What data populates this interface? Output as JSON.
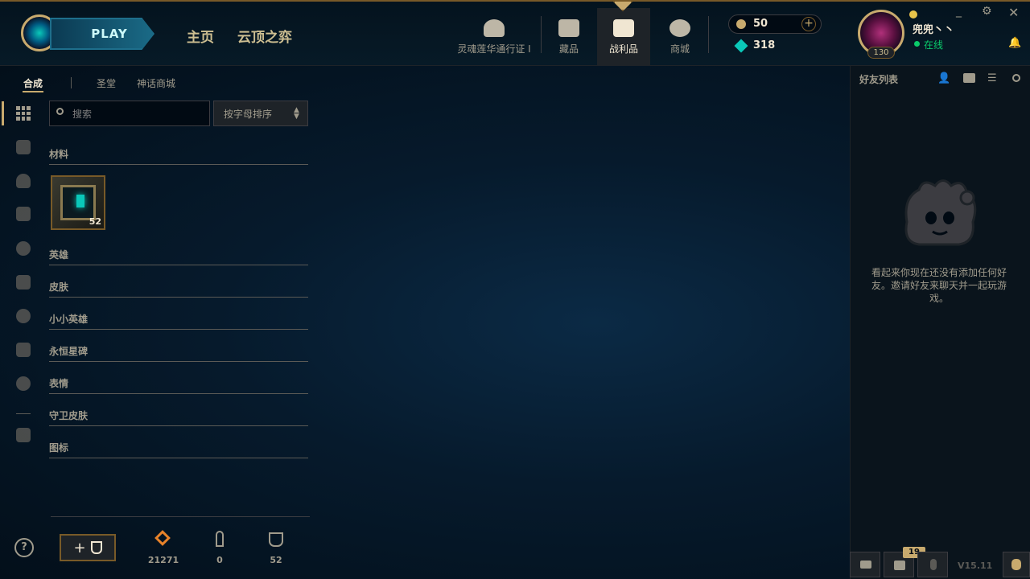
{
  "header": {
    "play_label": "PLAY",
    "nav": {
      "home": "主页",
      "tft": "云顶之弈"
    },
    "tabs": [
      {
        "label": "灵魂莲华通行证 I",
        "icon": "lotus-icon"
      },
      {
        "label": "藏品",
        "icon": "collection-icon"
      },
      {
        "label": "战利品",
        "icon": "loot-icon"
      },
      {
        "label": "商城",
        "icon": "store-icon"
      }
    ],
    "currency": {
      "rp": "50",
      "be": "318"
    },
    "profile": {
      "name": "兜兜丶丶",
      "status": "在线",
      "level": "130"
    }
  },
  "loot": {
    "subtabs": {
      "craft": "合成",
      "sanctum": "圣堂",
      "mythic": "神话商城"
    },
    "search_placeholder": "搜索",
    "sort_label": "按字母排序",
    "categories": {
      "materials": "材料",
      "champions": "英雄",
      "skins": "皮肤",
      "little_legends": "小小英雄",
      "eternals": "永恒星碑",
      "emotes": "表情",
      "ward_skins": "守卫皮肤",
      "icons": "图标"
    },
    "materials_items": [
      {
        "name": "hextech-chest",
        "count": "52"
      }
    ],
    "bottom": {
      "orange_essence": "21271",
      "keys": "0",
      "chests": "52"
    }
  },
  "friends": {
    "title": "好友列表",
    "empty_message": "看起来你现在还没有添加任何好友。邀请好友来聊天并一起玩游戏。"
  },
  "statusbar": {
    "notifications": "19",
    "version": "V15.11"
  },
  "colors": {
    "gold": "#c8aa6e",
    "teal": "#0ac8b9",
    "bg": "#010a13",
    "orange": "#e8832a"
  }
}
